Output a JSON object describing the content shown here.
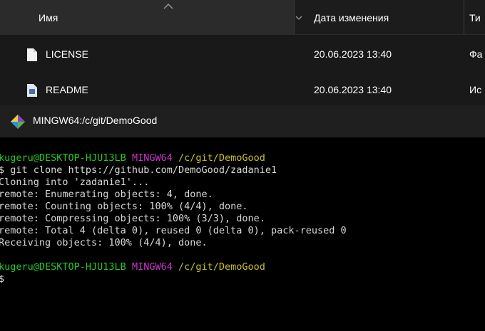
{
  "explorer": {
    "columns": {
      "name": "Имя",
      "date_modified": "Дата изменения",
      "type": "Ти"
    },
    "files": [
      {
        "name": "LICENSE",
        "date": "20.06.2023 13:40",
        "type": "Фа",
        "icon": "file-icon"
      },
      {
        "name": "README",
        "date": "20.06.2023 13:40",
        "type": "Ис",
        "icon": "markdown-file-icon"
      }
    ]
  },
  "terminal": {
    "title": "MINGW64:/c/git/DemoGood",
    "prompt1": {
      "user_host": "kugeru@DESKTOP-HJU13LB",
      "env": "MINGW64",
      "path": "/c/git/DemoGood"
    },
    "lines": [
      "$ git clone https://github.com/DemoGood/zadanie1",
      "Cloning into 'zadanie1'...",
      "remote: Enumerating objects: 4, done.",
      "remote: Counting objects: 100% (4/4), done.",
      "remote: Compressing objects: 100% (3/3), done.",
      "remote: Total 4 (delta 0), reused 0 (delta 0), pack-reused 0",
      "Receiving objects: 100% (4/4), done."
    ],
    "prompt2": {
      "user_host": "kugeru@DESKTOP-HJU13LB",
      "env": "MINGW64",
      "path": "/c/git/DemoGood"
    },
    "cursor_line": "$"
  },
  "colors": {
    "prompt_user": "#27c927",
    "prompt_env": "#c936c9",
    "prompt_path": "#c9c127"
  }
}
